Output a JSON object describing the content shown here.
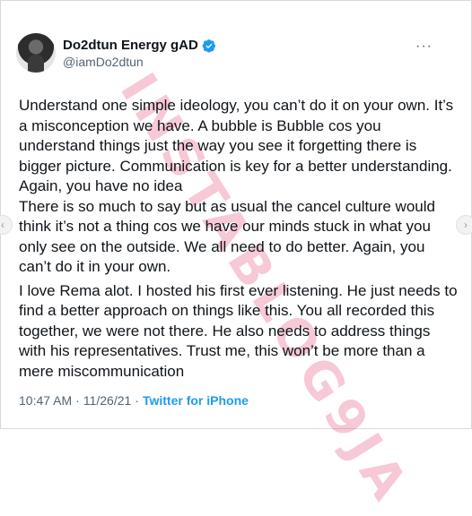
{
  "tweet": {
    "display_name": "Do2dtun Energy gAD",
    "handle": "@iamDo2dtun",
    "verified_icon": "verified-badge-icon",
    "more_icon": "more-options-icon",
    "paragraphs": [
      "Understand one simple ideology, you can’t do it on your own. It’s a misconception we have. A bubble is Bubble cos you understand things just the way you see it forgetting there is bigger picture. Communication is key for a better understanding. Again, you have no idea",
      "There is so much to say but as usual the cancel culture would think it’s not a thing cos we have our minds stuck in what you only see on the outside. We all need to do better. Again, you can’t do it in your own.",
      "I love Rema alot. I hosted his first ever listening. He just needs to find a better approach on things like this. You all recorded this together, we were not there. He also needs to address things with his representatives. Trust me, this won’t be more than a mere miscommunication"
    ],
    "time": "10:47 AM",
    "separator": "·",
    "date": "11/26/21",
    "separator2": "·",
    "source": "Twitter for iPhone"
  },
  "watermark": {
    "text": "INSTABLOG9JA"
  },
  "colors": {
    "verified": "#1d9bf0",
    "muted": "#536471",
    "watermark": "#e75480"
  }
}
